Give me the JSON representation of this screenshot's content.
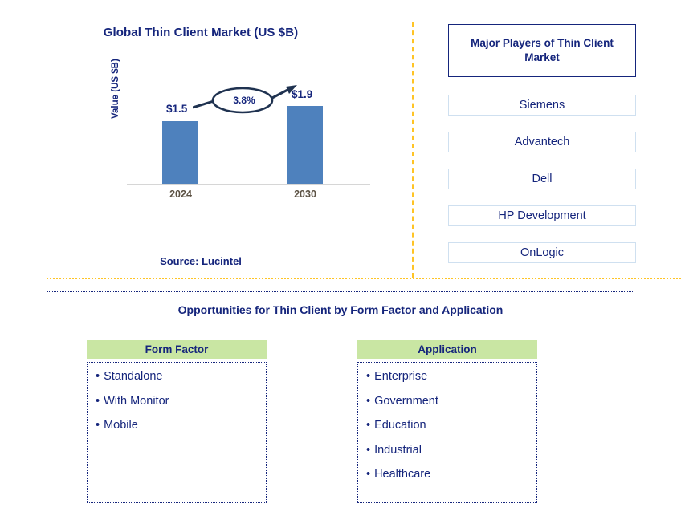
{
  "chart_panel": {
    "title": "Global Thin Client Market (US $B)",
    "y_axis_label": "Value (US $B)",
    "source": "Source: Lucintel"
  },
  "chart_data": {
    "type": "bar",
    "title": "Global Thin Client Market (US $B)",
    "categories": [
      "2024",
      "2030"
    ],
    "values": [
      1.5,
      1.9
    ],
    "value_labels": [
      "$1.5",
      "$1.9"
    ],
    "cagr_label": "3.8%",
    "xlabel": "",
    "ylabel": "Value (US $B)",
    "ylim": [
      0,
      2.2
    ],
    "grid": false,
    "legend": "none",
    "series_color": "#4e81bd"
  },
  "players_panel": {
    "header": "Major Players of Thin Client Market",
    "items": [
      {
        "label": "Siemens"
      },
      {
        "label": "Advantech"
      },
      {
        "label": "Dell"
      },
      {
        "label": "HP Development"
      },
      {
        "label": "OnLogic"
      }
    ]
  },
  "opportunities": {
    "banner": "Opportunities for Thin Client by Form Factor and Application",
    "columns": [
      {
        "header": "Form Factor",
        "items": [
          "Standalone",
          "With Monitor",
          "Mobile"
        ]
      },
      {
        "header": "Application",
        "items": [
          "Enterprise",
          "Government",
          "Education",
          "Industrial",
          "Healthcare"
        ]
      }
    ]
  },
  "bullet": "•",
  "colors": {
    "navy": "#15257c",
    "bar_blue": "#4e81bd",
    "divider_orange": "#ffc425",
    "header_green": "#c9e6a3",
    "player_border": "#cfe0f0"
  }
}
